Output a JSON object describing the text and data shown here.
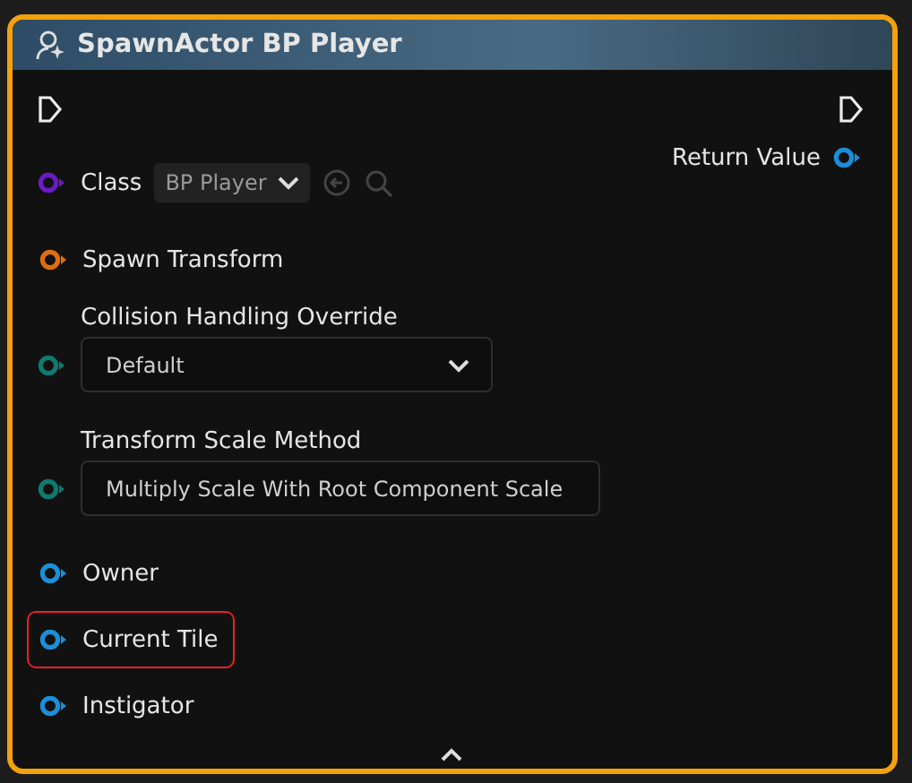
{
  "node": {
    "title": "SpawnActor BP Player",
    "selected": true
  },
  "inputs": [
    {
      "kind": "class",
      "label": "Class",
      "color": "#6a1bc4",
      "value": "BP Player"
    },
    {
      "kind": "simple",
      "label": "Spawn Transform",
      "color": "#e06e10",
      "highlighted": false
    },
    {
      "kind": "enum",
      "label": "Collision Handling Override",
      "color": "#0e7a70",
      "value": "Default"
    },
    {
      "kind": "enum",
      "label": "Transform Scale Method",
      "color": "#0e7a70",
      "value": "Multiply Scale With Root Component Scale"
    },
    {
      "kind": "simple",
      "label": "Owner",
      "color": "#1c8ed8",
      "highlighted": false
    },
    {
      "kind": "simple",
      "label": "Current Tile",
      "color": "#1c8ed8",
      "highlighted": true
    },
    {
      "kind": "simple",
      "label": "Instigator",
      "color": "#1c8ed8",
      "highlighted": false
    }
  ],
  "outputs": [
    {
      "label": "Return Value",
      "color": "#1c8ed8"
    }
  ]
}
